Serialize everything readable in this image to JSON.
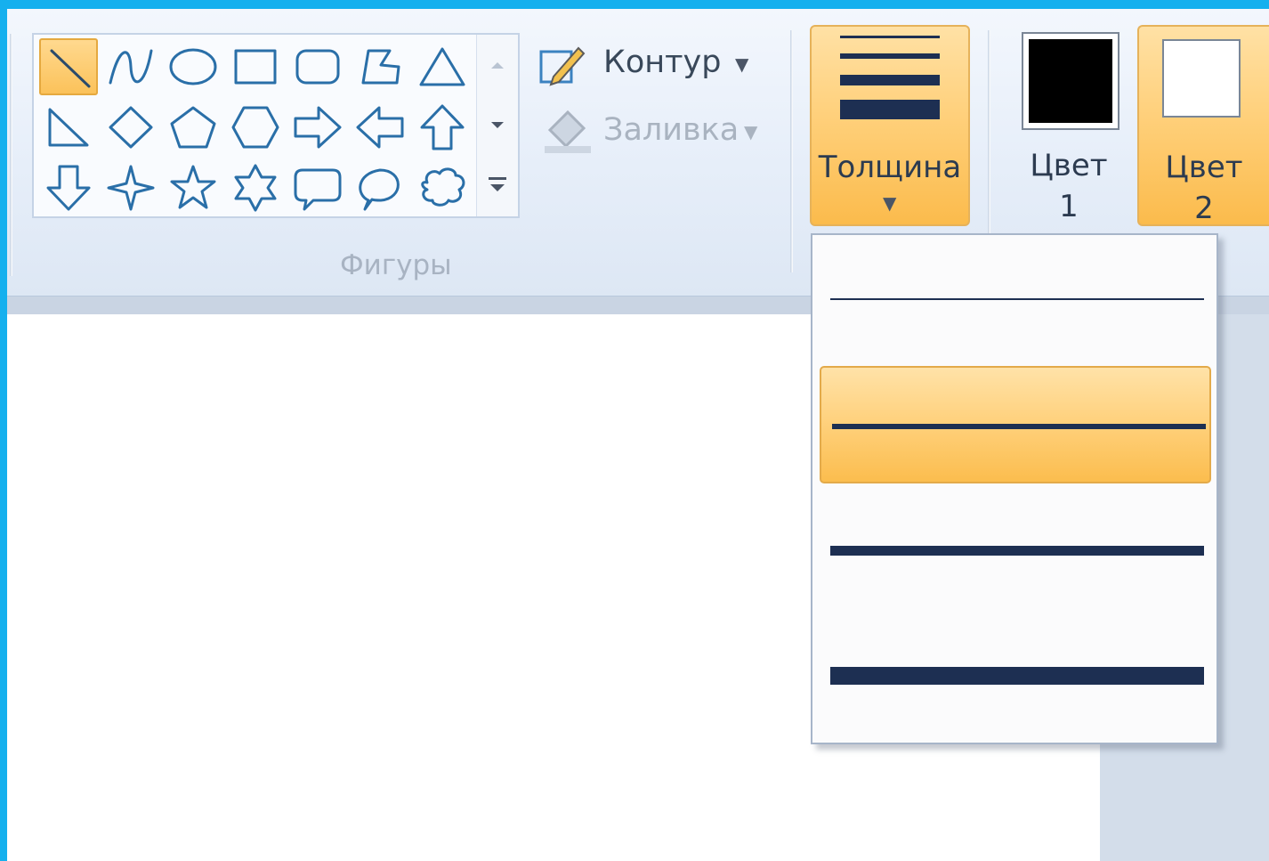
{
  "ribbon": {
    "outline_label": "Контур",
    "fill_label": "Заливка",
    "shapes_group_label": "Фигуры",
    "shapes": [
      "line-icon",
      "curve-icon",
      "oval-icon",
      "rectangle-icon",
      "rounded-rectangle-icon",
      "polygon-icon",
      "triangle-icon",
      "right-triangle-icon",
      "diamond-icon",
      "pentagon-icon",
      "hexagon-icon",
      "arrow-right-icon",
      "arrow-left-icon",
      "arrow-up-icon",
      "arrow-down-icon",
      "star-four-icon",
      "star-five-icon",
      "star-six-icon",
      "callout-rounded-icon",
      "callout-oval-icon",
      "callout-cloud-icon"
    ],
    "selected_shape": "line-icon",
    "size_button": {
      "label": "Толщина"
    },
    "color1": {
      "label_line1": "Цвет",
      "label_line2": "1",
      "value": "#000000"
    },
    "color2": {
      "label_line1": "Цвет",
      "label_line2": "2",
      "value": "#ffffff"
    }
  },
  "thickness_menu": {
    "options": [
      "1px",
      "3px",
      "5px",
      "8px"
    ],
    "selected_index": 1
  },
  "colors": {
    "accent": "#fbc25a",
    "ribbon": "#e6eef9",
    "icon_stroke": "#2a6fa8",
    "line_color": "#1d2f52",
    "frame": "#15b0ee"
  }
}
